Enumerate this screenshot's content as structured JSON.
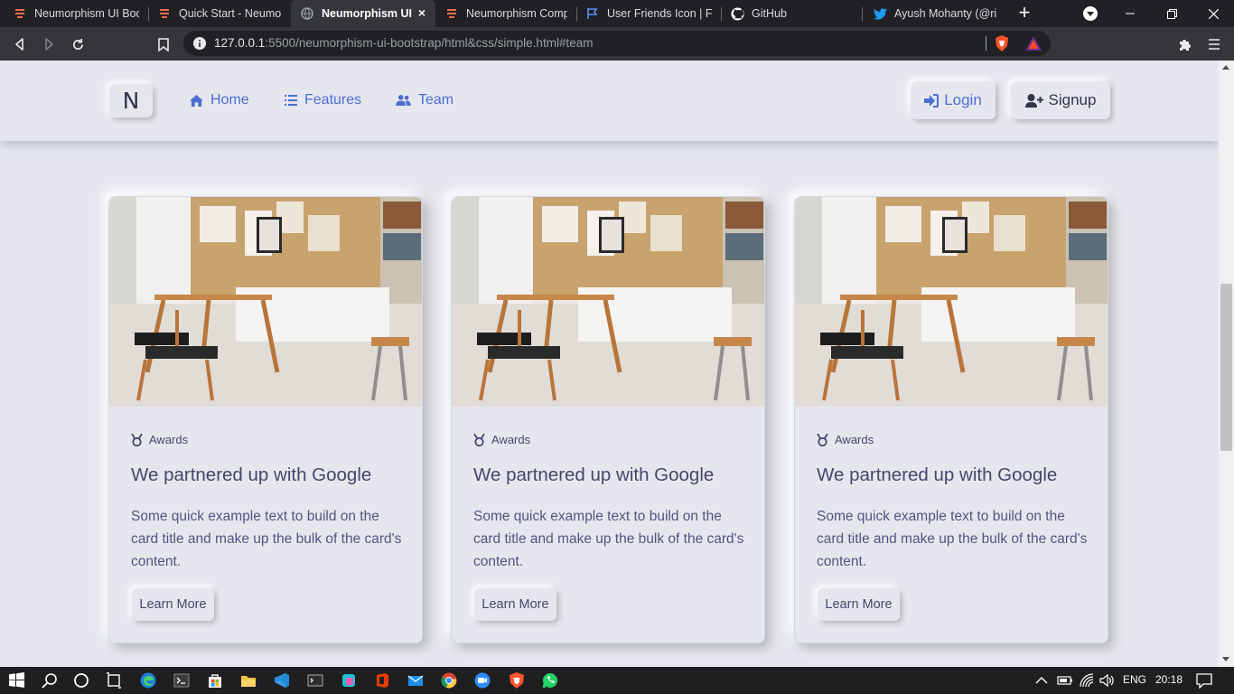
{
  "browser": {
    "tabs": [
      {
        "label": "Neumorphism UI Boots",
        "icon": "themesberg-icon"
      },
      {
        "label": "Quick Start - Neumorph",
        "icon": "themesberg-icon"
      },
      {
        "label": "Neumorphism UI",
        "icon": "globe-icon",
        "active": true
      },
      {
        "label": "Neumorphism Compon",
        "icon": "themesberg-icon"
      },
      {
        "label": "User Friends Icon | Fon",
        "icon": "fontawesome-flag-icon"
      },
      {
        "label": "GitHub",
        "icon": "github-icon"
      },
      {
        "label": "Ayush Mohanty (@rim",
        "icon": "twitter-icon"
      }
    ],
    "close_glyph": "×",
    "new_tab_glyph": "+",
    "url_host": "127.0.0.1",
    "url_path": ":5500/neumorphism-ui-bootstrap/html&css/simple.html#team"
  },
  "navbar": {
    "brand": "N",
    "links": [
      {
        "label": "Home",
        "icon": "home-icon"
      },
      {
        "label": "Features",
        "icon": "list-icon"
      },
      {
        "label": "Team",
        "icon": "user-friends-icon"
      }
    ],
    "login_label": "Login",
    "signup_label": "Signup",
    "accent": "#4c6ed0",
    "text_color": "#31344b"
  },
  "cards": [
    {
      "badge": "Awards",
      "title": "We partnered up with Google",
      "text": "Some quick example text to build on the card title and make up the bulk of the card's content.",
      "button": "Learn More"
    },
    {
      "badge": "Awards",
      "title": "We partnered up with Google",
      "text": "Some quick example text to build on the card title and make up the bulk of the card's content.",
      "button": "Learn More"
    },
    {
      "badge": "Awards",
      "title": "We partnered up with Google",
      "text": "Some quick example text to build on the card title and make up the bulk of the card's content.",
      "button": "Learn More"
    }
  ],
  "taskbar": {
    "language": "ENG",
    "time": "20:18"
  },
  "colors": {
    "page_bg": "#e6e7ee",
    "chrome_dark": "#202124",
    "chrome_toolbar": "#35363a"
  }
}
